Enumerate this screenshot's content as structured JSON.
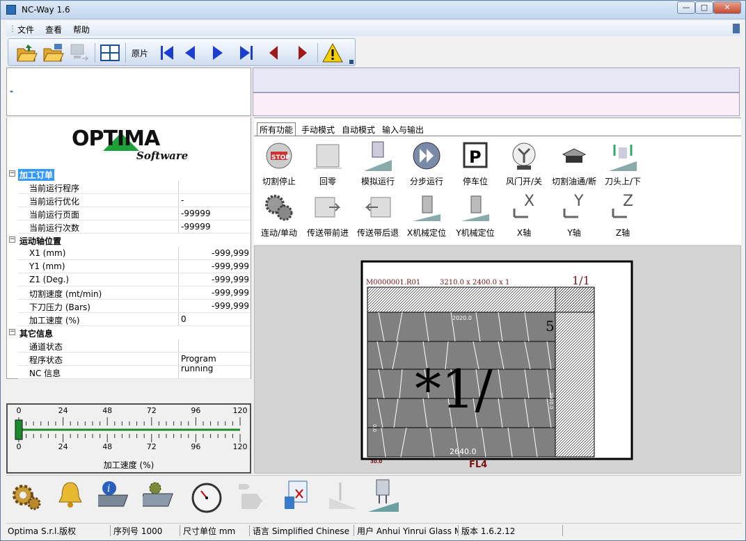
{
  "window": {
    "title": "NC-Way 1.6",
    "min": "—",
    "max": "□",
    "close": "✕"
  },
  "menu": {
    "file": "文件",
    "view": "查看",
    "help": "帮助"
  },
  "toolbar": {
    "sheet_label": "原片"
  },
  "left_message": "-",
  "logo": {
    "brand": "OPTIMA",
    "sub": "Software"
  },
  "props": {
    "sections": [
      {
        "title": "加工订单",
        "rows": [
          {
            "k": "当前运行程序",
            "v": ""
          },
          {
            "k": "当前运行优化",
            "v": "-"
          },
          {
            "k": "当前运行页面",
            "v": "-99999"
          },
          {
            "k": "当前运行次数",
            "v": "-99999"
          }
        ]
      },
      {
        "title": "运动轴位置",
        "rows": [
          {
            "k": "X1 (mm)",
            "v": "-999,999"
          },
          {
            "k": "Y1 (mm)",
            "v": "-999,999"
          },
          {
            "k": "Z1 (Deg.)",
            "v": "-999,999"
          },
          {
            "k": "切割速度 (mt/min)",
            "v": "-999,999"
          },
          {
            "k": "下刀压力 (Bars)",
            "v": "-999,999"
          },
          {
            "k": "加工速度 (%)",
            "v": "0"
          }
        ]
      },
      {
        "title": "其它信息",
        "rows": [
          {
            "k": "通道状态",
            "v": ""
          },
          {
            "k": "程序状态",
            "v": "Program running"
          },
          {
            "k": "NC 信息",
            "v": ""
          }
        ]
      }
    ]
  },
  "slider": {
    "ticks": [
      "0",
      "24",
      "48",
      "72",
      "96",
      "120"
    ],
    "label": "加工速度 (%)",
    "value": 0
  },
  "tabs": [
    "所有功能",
    "手动模式",
    "自动模式",
    "输入与输出"
  ],
  "functions_row1": [
    "切割停止",
    "回零",
    "模拟运行",
    "分步运行",
    "停车位",
    "风门开/关",
    "切割油通/断",
    "刀头上/下"
  ],
  "functions_row2": [
    "连动/单动",
    "传送带前进",
    "传送带后退",
    "X机械定位",
    "Y机械定位",
    "X轴",
    "Y轴",
    "Z轴"
  ],
  "preview": {
    "header": "M0000001.R01",
    "dims": "3210.0 x  2400.0 x 1",
    "page": "1/1",
    "big_text": "*1/",
    "num5": "5",
    "top_dim": "2020.0",
    "bottom_dim": "2640.0",
    "side_dim": "2000.0",
    "left_dim": "0.0",
    "corner": "30.0",
    "footer": "FL4"
  },
  "status": {
    "copyright": "Optima S.r.l.版权",
    "serial": "序列号 1000",
    "unit": "尺寸单位 mm",
    "language": "语言 Simplified Chinese",
    "user": "用户 Anhui Yinrui Glass Ma",
    "version": "版本 1.6.2.12"
  },
  "colors": {
    "selection": "#3399ff",
    "accent": "#1f3fae",
    "warn": "#f5d000"
  }
}
